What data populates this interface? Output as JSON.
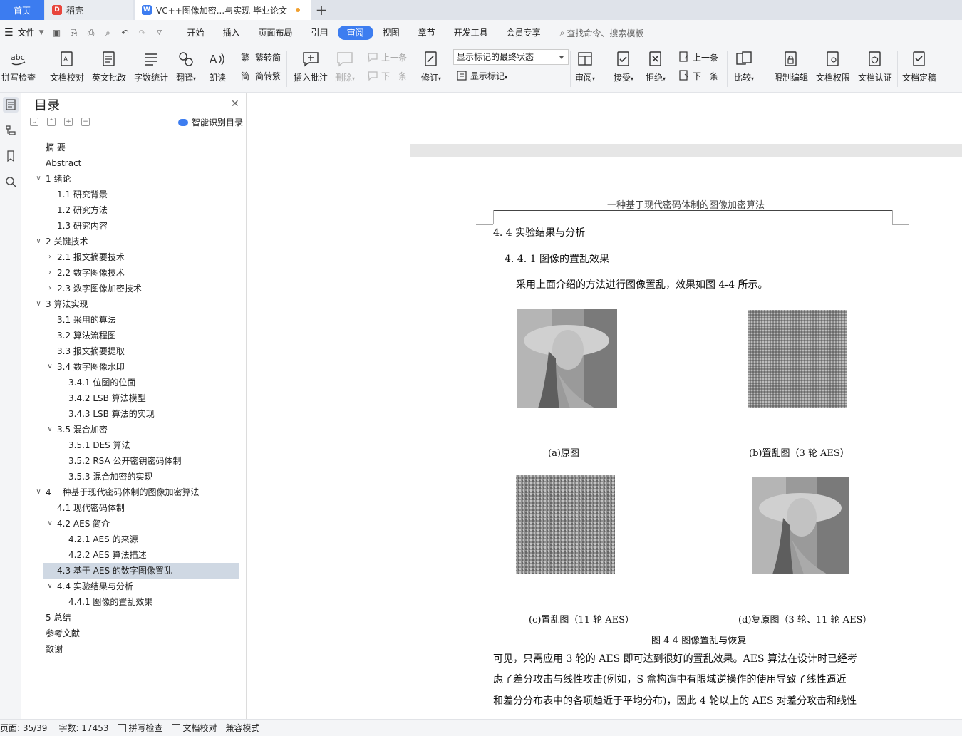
{
  "tabs": {
    "home": "首页",
    "daoke": "稻壳",
    "doc": "VC++图像加密...与实现 毕业论文"
  },
  "menu": {
    "file": "文件",
    "items": [
      "开始",
      "插入",
      "页面布局",
      "引用",
      "审阅",
      "视图",
      "章节",
      "开发工具",
      "会员专享"
    ],
    "active": "审阅",
    "search": "查找命令、搜索模板"
  },
  "ribbon": {
    "spell": "拼写检查",
    "proofread": "文档校对",
    "en_review": "英文批改",
    "word_count": "字数统计",
    "translate": "翻译",
    "read_aloud": "朗读",
    "to_traditional": "繁转简",
    "to_simplified": "简转繁",
    "insert_comment": "插入批注",
    "delete": "删除",
    "prev_comment": "上一条",
    "next_comment": "下一条",
    "revise": "修订",
    "markup_state": "显示标记的最终状态",
    "show_markup": "显示标记",
    "review": "审阅",
    "accept": "接受",
    "reject": "拒绝",
    "prev_change": "上一条",
    "next_change": "下一条",
    "compare": "比较",
    "restrict_edit": "限制编辑",
    "doc_permission": "文档权限",
    "doc_certify": "文档认证",
    "doc_finalize": "文档定稿"
  },
  "toc": {
    "title": "目录",
    "smart": "智能识别目录",
    "items": [
      {
        "label": "摘  要",
        "level": 0,
        "chev": ""
      },
      {
        "label": "Abstract",
        "level": 0,
        "chev": ""
      },
      {
        "label": "1  绪论",
        "level": 0,
        "chev": "open"
      },
      {
        "label": "1.1  研究背景",
        "level": 1,
        "chev": ""
      },
      {
        "label": "1.2  研究方法",
        "level": 1,
        "chev": ""
      },
      {
        "label": "1.3  研究内容",
        "level": 1,
        "chev": ""
      },
      {
        "label": "2  关键技术",
        "level": 0,
        "chev": "open"
      },
      {
        "label": "2.1  报文摘要技术",
        "level": 1,
        "chev": "closed"
      },
      {
        "label": "2.2  数字图像技术",
        "level": 1,
        "chev": "closed"
      },
      {
        "label": "2.3  数字图像加密技术",
        "level": 1,
        "chev": "closed"
      },
      {
        "label": "3  算法实现",
        "level": 0,
        "chev": "open"
      },
      {
        "label": "3.1  采用的算法",
        "level": 1,
        "chev": ""
      },
      {
        "label": "3.2  算法流程图",
        "level": 1,
        "chev": ""
      },
      {
        "label": "3.3  报文摘要提取",
        "level": 1,
        "chev": ""
      },
      {
        "label": "3.4  数字图像水印",
        "level": 1,
        "chev": "open"
      },
      {
        "label": "3.4.1  位图的位面",
        "level": 2,
        "chev": ""
      },
      {
        "label": "3.4.2 LSB 算法模型",
        "level": 2,
        "chev": ""
      },
      {
        "label": "3.4.3 LSB 算法的实现",
        "level": 2,
        "chev": ""
      },
      {
        "label": "3.5  混合加密",
        "level": 1,
        "chev": "open"
      },
      {
        "label": "3.5.1 DES 算法",
        "level": 2,
        "chev": ""
      },
      {
        "label": "3.5.2 RSA 公开密钥密码体制",
        "level": 2,
        "chev": ""
      },
      {
        "label": "3.5.3  混合加密的实现",
        "level": 2,
        "chev": ""
      },
      {
        "label": "4  一种基于现代密码体制的图像加密算法",
        "level": 0,
        "chev": "open"
      },
      {
        "label": "4.1 现代密码体制",
        "level": 1,
        "chev": ""
      },
      {
        "label": "4.2 AES 简介",
        "level": 1,
        "chev": "open"
      },
      {
        "label": "4.2.1 AES 的来源",
        "level": 2,
        "chev": ""
      },
      {
        "label": "4.2.2 AES 算法描述",
        "level": 2,
        "chev": ""
      },
      {
        "label": "4.3  基于 AES 的数字图像置乱",
        "level": 1,
        "chev": "",
        "selected": true
      },
      {
        "label": "4.4  实验结果与分析",
        "level": 1,
        "chev": "open"
      },
      {
        "label": "4.4.1  图像的置乱效果",
        "level": 2,
        "chev": ""
      },
      {
        "label": "5  总结",
        "level": 0,
        "chev": ""
      },
      {
        "label": "参考文献",
        "level": 0,
        "chev": ""
      },
      {
        "label": "致谢",
        "level": 0,
        "chev": ""
      }
    ]
  },
  "document": {
    "running_header": "一种基于现代密码体制的图像加密算法",
    "section": "4. 4  实验结果与分析",
    "subsection": "4. 4. 1  图像的置乱效果",
    "intro": "采用上面介绍的方法进行图像置乱，效果如图 4-4 所示。",
    "caption_a": "(a)原图",
    "caption_b": "(b)置乱图（3 轮 AES）",
    "caption_c": "(c)置乱图（11 轮 AES）",
    "caption_d": "(d)复原图（3 轮、11 轮 AES）",
    "figure_caption": "图 4-4  图像置乱与恢复",
    "para_lines": [
      "可见，只需应用 3 轮的 AES 即可达到很好的置乱效果。AES 算法在设计时已经考",
      "虑了差分攻击与线性攻击(例如，S 盒构造中有限域逆操作的使用导致了线性逼近",
      "和差分分布表中的各项趋近于平均分布)，因此 4 轮以上的 AES 对差分攻击和线性"
    ]
  },
  "status": {
    "page": "页面: 35/39",
    "words": "字数: 17453",
    "spell": "拼写检查",
    "proof": "文档校对",
    "compat": "兼容模式"
  }
}
